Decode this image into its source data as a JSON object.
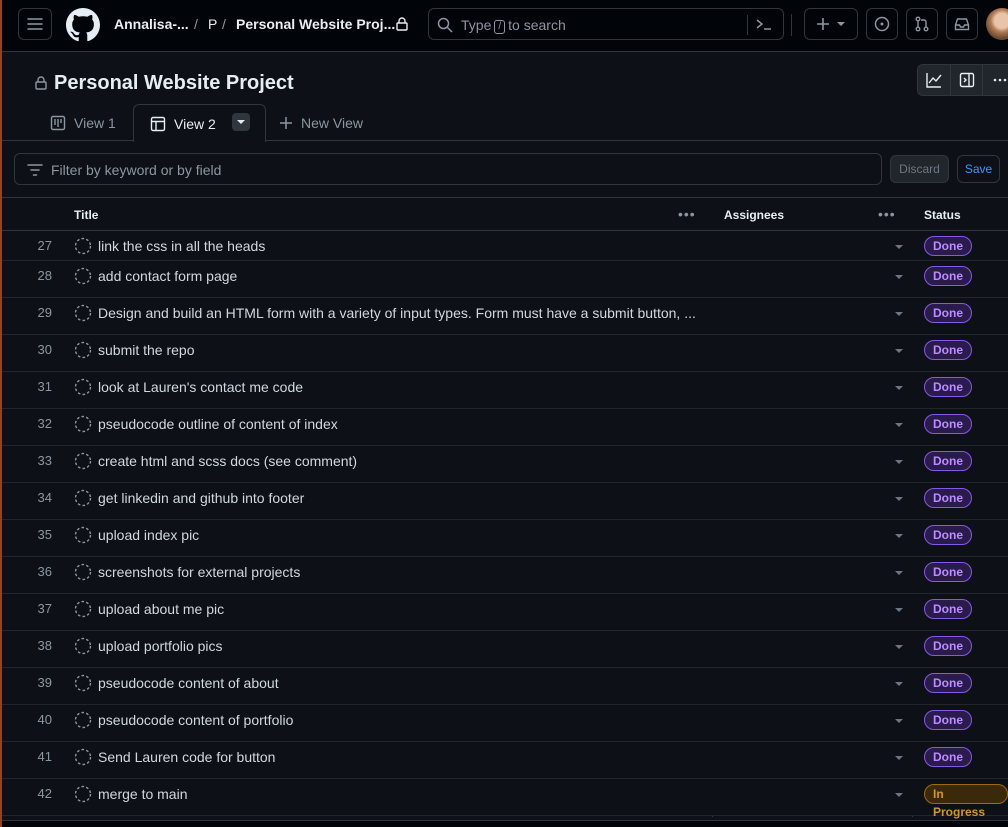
{
  "header": {
    "owner": "Annalisa-...",
    "separator": "/",
    "repo_initial": "P",
    "project_crumb": "Personal Website Proj...",
    "search_prefix": "Type",
    "search_key": "/",
    "search_suffix": "to search"
  },
  "project": {
    "title": "Personal Website Project"
  },
  "tabs": [
    {
      "label": "View 1"
    },
    {
      "label": "View 2"
    },
    {
      "label": "New View"
    }
  ],
  "filter": {
    "placeholder": "Filter by keyword or by field",
    "discard_label": "Discard",
    "save_label": "Save"
  },
  "table": {
    "columns": [
      "Title",
      "Assignees",
      "Status"
    ],
    "rows": [
      {
        "num": "27",
        "title": "link the css in all the heads",
        "status": "Done"
      },
      {
        "num": "28",
        "title": "add contact form page",
        "status": "Done"
      },
      {
        "num": "29",
        "title": "Design and build an HTML form with a variety of input types. Form must have a submit button, ...",
        "status": "Done"
      },
      {
        "num": "30",
        "title": "submit the repo",
        "status": "Done"
      },
      {
        "num": "31",
        "title": "look at Lauren's contact me code",
        "status": "Done"
      },
      {
        "num": "32",
        "title": "pseudocode outline of content of index",
        "status": "Done"
      },
      {
        "num": "33",
        "title": "create html and scss docs (see comment)",
        "status": "Done"
      },
      {
        "num": "34",
        "title": "get linkedin and github into footer",
        "status": "Done"
      },
      {
        "num": "35",
        "title": "upload index pic",
        "status": "Done"
      },
      {
        "num": "36",
        "title": "screenshots for external projects",
        "status": "Done"
      },
      {
        "num": "37",
        "title": "upload about me pic",
        "status": "Done"
      },
      {
        "num": "38",
        "title": "upload portfolio pics",
        "status": "Done"
      },
      {
        "num": "39",
        "title": "pseudocode content of about",
        "status": "Done"
      },
      {
        "num": "40",
        "title": "pseudocode content of portfolio",
        "status": "Done"
      },
      {
        "num": "41",
        "title": "Send Lauren code for button",
        "status": "Done"
      },
      {
        "num": "42",
        "title": "merge to main",
        "status": "In Progress"
      }
    ]
  },
  "colors": {
    "done": "#bc8cff",
    "in_progress": "#d29922",
    "accent": "#4493f8"
  }
}
